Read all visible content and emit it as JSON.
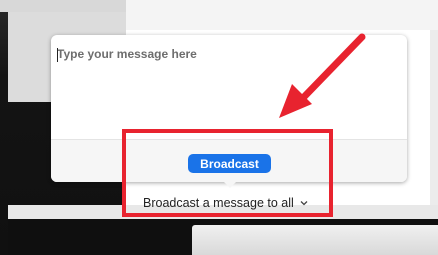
{
  "broadcast_popup": {
    "message_placeholder": "Type your message here",
    "broadcast_button_label": "Broadcast"
  },
  "broadcast_target": {
    "label": "Broadcast a message to all",
    "icon": "chevron-down-icon"
  },
  "annotation": {
    "highlight_color": "#e8232f",
    "arrow_color": "#e8232f"
  },
  "colors": {
    "button_blue": "#1a73e8"
  }
}
